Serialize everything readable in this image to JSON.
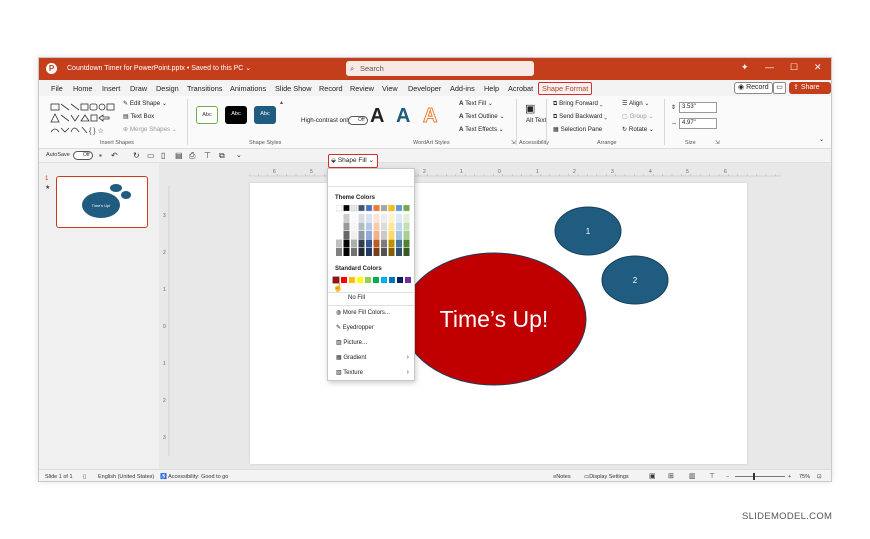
{
  "titlebar": {
    "doc_title": "Countdown Timer for PowerPoint.pptx • Saved to this PC ⌄",
    "search_placeholder": "Search",
    "minimize": "—",
    "maximize": "☐",
    "close": "✕"
  },
  "menu": {
    "tabs": [
      "File",
      "Home",
      "Insert",
      "Draw",
      "Design",
      "Transitions",
      "Animations",
      "Slide Show",
      "Record",
      "Review",
      "View",
      "Developer",
      "Add-ins",
      "Help",
      "Acrobat"
    ],
    "active_tab": "Shape Format",
    "record_label": "Record",
    "share_label": "Share"
  },
  "ribbon": {
    "insert_shapes": {
      "edit_shape": "Edit Shape",
      "text_box": "Text Box",
      "merge_shapes": "Merge Shapes",
      "label": "Insert Shapes"
    },
    "shape_styles": {
      "abc": "Abc",
      "label": "Shape Styles"
    },
    "shape_fill_label": "Shape Fill",
    "high_contrast": "High-contrast only",
    "toggle_text": "Off",
    "wordart": {
      "text_fill": "Text Fill",
      "text_outline": "Text Outline",
      "text_effects": "Text Effects",
      "label": "WordArt Styles"
    },
    "accessibility": {
      "alt_text": "Alt Text",
      "label": "Accessibility"
    },
    "arrange": {
      "bring_forward": "Bring Forward",
      "send_backward": "Send Backward",
      "selection_pane": "Selection Pane",
      "align": "Align",
      "group": "Group",
      "rotate": "Rotate",
      "label": "Arrange"
    },
    "size": {
      "height": "3.53\"",
      "width": "4.97\"",
      "label": "Size"
    }
  },
  "qat": {
    "autosave": "AutoSave",
    "toggle": "Off"
  },
  "dropdown": {
    "theme_colors_label": "Theme Colors",
    "standard_colors_label": "Standard Colors",
    "no_fill": "No Fill",
    "more_fill_colors": "More Fill Colors...",
    "eyedropper": "Eyedropper",
    "picture": "Picture...",
    "gradient": "Gradient",
    "texture": "Texture",
    "theme_top": [
      "#ffffff",
      "#000000",
      "#e7e6e6",
      "#44546a",
      "#4472c4",
      "#ed7d31",
      "#a5a5a5",
      "#ffc000",
      "#5b9bd5",
      "#70ad47"
    ],
    "standard": [
      "#c00000",
      "#ff0000",
      "#ffc000",
      "#ffff00",
      "#92d050",
      "#00b050",
      "#00b0f0",
      "#0070c0",
      "#002060",
      "#7030a0"
    ]
  },
  "slide": {
    "main_text": "Time’s Up!",
    "circle1": "1",
    "circle2": "2",
    "main_color": "#c00000",
    "small_color": "#1f5c80"
  },
  "thumbnail": {
    "number": "1",
    "text": "Time's Up!"
  },
  "ruler": {
    "h_labels": [
      "6",
      "5",
      "4",
      "3",
      "2",
      "1",
      "0",
      "1",
      "2",
      "3",
      "4",
      "5",
      "6"
    ],
    "v_labels": [
      "3",
      "2",
      "1",
      "0",
      "1",
      "2",
      "3"
    ]
  },
  "status": {
    "slide_of": "Slide 1 of 1",
    "language": "English (United States)",
    "accessibility": "Accessibility: Good to go",
    "notes": "Notes",
    "display_settings": "Display Settings",
    "zoom": "75%"
  },
  "watermark": "SLIDEMODEL.COM"
}
